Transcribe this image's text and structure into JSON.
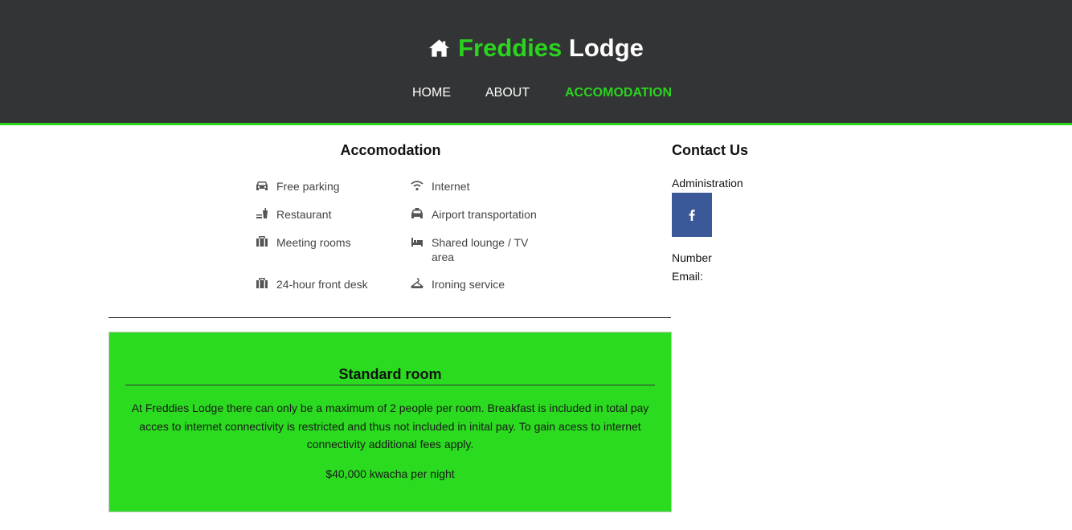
{
  "header": {
    "brand_first": "Freddies",
    "brand_second": "Lodge",
    "brand_icon": "home-icon",
    "accent_color": "#2ad41e",
    "background_color": "#333435"
  },
  "nav": {
    "items": [
      {
        "label": "HOME",
        "active": false
      },
      {
        "label": "ABOUT",
        "active": false
      },
      {
        "label": "ACCOMODATION",
        "active": true
      }
    ]
  },
  "accommodation": {
    "title": "Accomodation",
    "amenities": [
      {
        "label": "Free parking",
        "icon": "car-icon"
      },
      {
        "label": "Internet",
        "icon": "wifi-icon"
      },
      {
        "label": "Restaurant",
        "icon": "restaurant-icon"
      },
      {
        "label": "Airport transportation",
        "icon": "taxi-icon"
      },
      {
        "label": "Meeting rooms",
        "icon": "briefcase-icon"
      },
      {
        "label": "Shared lounge / TV area",
        "icon": "bed-icon"
      },
      {
        "label": "24-hour front desk",
        "icon": "briefcase-icon"
      },
      {
        "label": "Ironing service",
        "icon": "hanger-icon"
      }
    ]
  },
  "room": {
    "title": "Standard room",
    "description": "At Freddies Lodge there can only be a maximum of 2 people per room. Breakfast is included in total pay acces to internet connectivity is restricted and thus not included in inital pay. To gain acess to internet connectivity additional fees apply.",
    "price": "$40,000 kwacha per night",
    "card_color": "#2bdb1f"
  },
  "contact": {
    "title": "Contact Us",
    "admin_label": "Administration",
    "facebook_icon": "facebook-icon",
    "facebook_color": "#3b5998",
    "number_label": "Number",
    "email_label": "Email:"
  }
}
